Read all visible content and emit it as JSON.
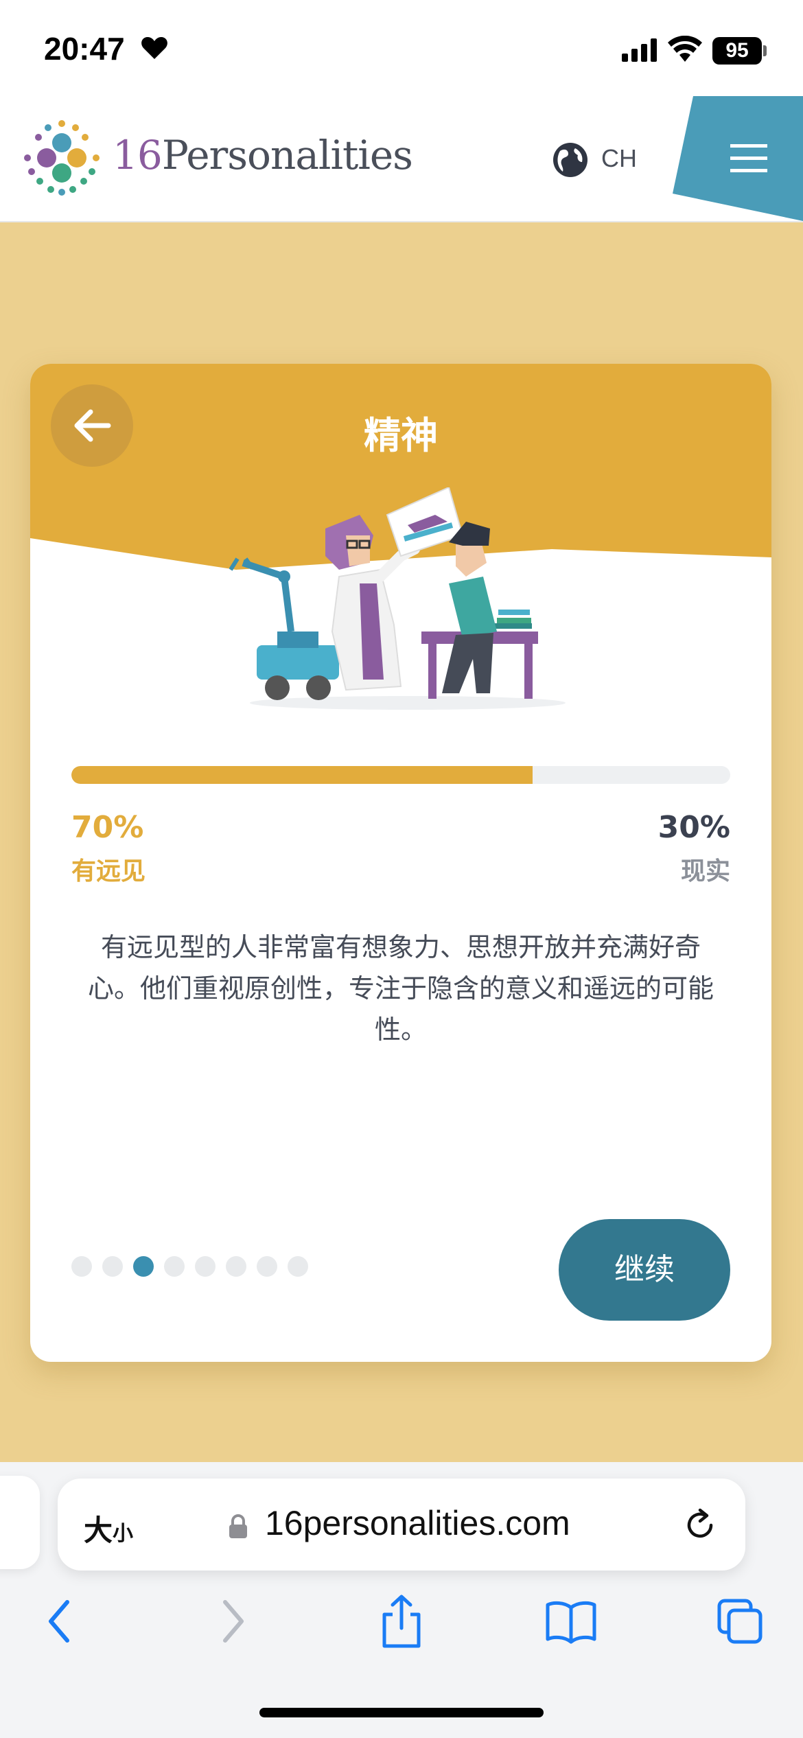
{
  "status": {
    "time": "20:47",
    "battery": "95"
  },
  "header": {
    "brand_num": "16",
    "brand_text": "Personalities",
    "language": "CH"
  },
  "card": {
    "title": "精神",
    "progress_percent": 70,
    "left": {
      "percent": "70%",
      "label": "有远见"
    },
    "right": {
      "percent": "30%",
      "label": "现实"
    },
    "description": "有远见型的人非常富有想象力、思想开放并充满好奇心。他们重视原创性，专注于隐含的意义和遥远的可能性。",
    "pager": {
      "count": 8,
      "active": 2
    },
    "continue_label": "继续"
  },
  "browser": {
    "text_size_big": "大",
    "text_size_small": "小",
    "url": "16personalities.com"
  },
  "colors": {
    "accent_yellow": "#e2ac3c",
    "teal": "#33788f",
    "header_blue": "#4a9cb8",
    "background_yellow": "#ecd08f"
  }
}
